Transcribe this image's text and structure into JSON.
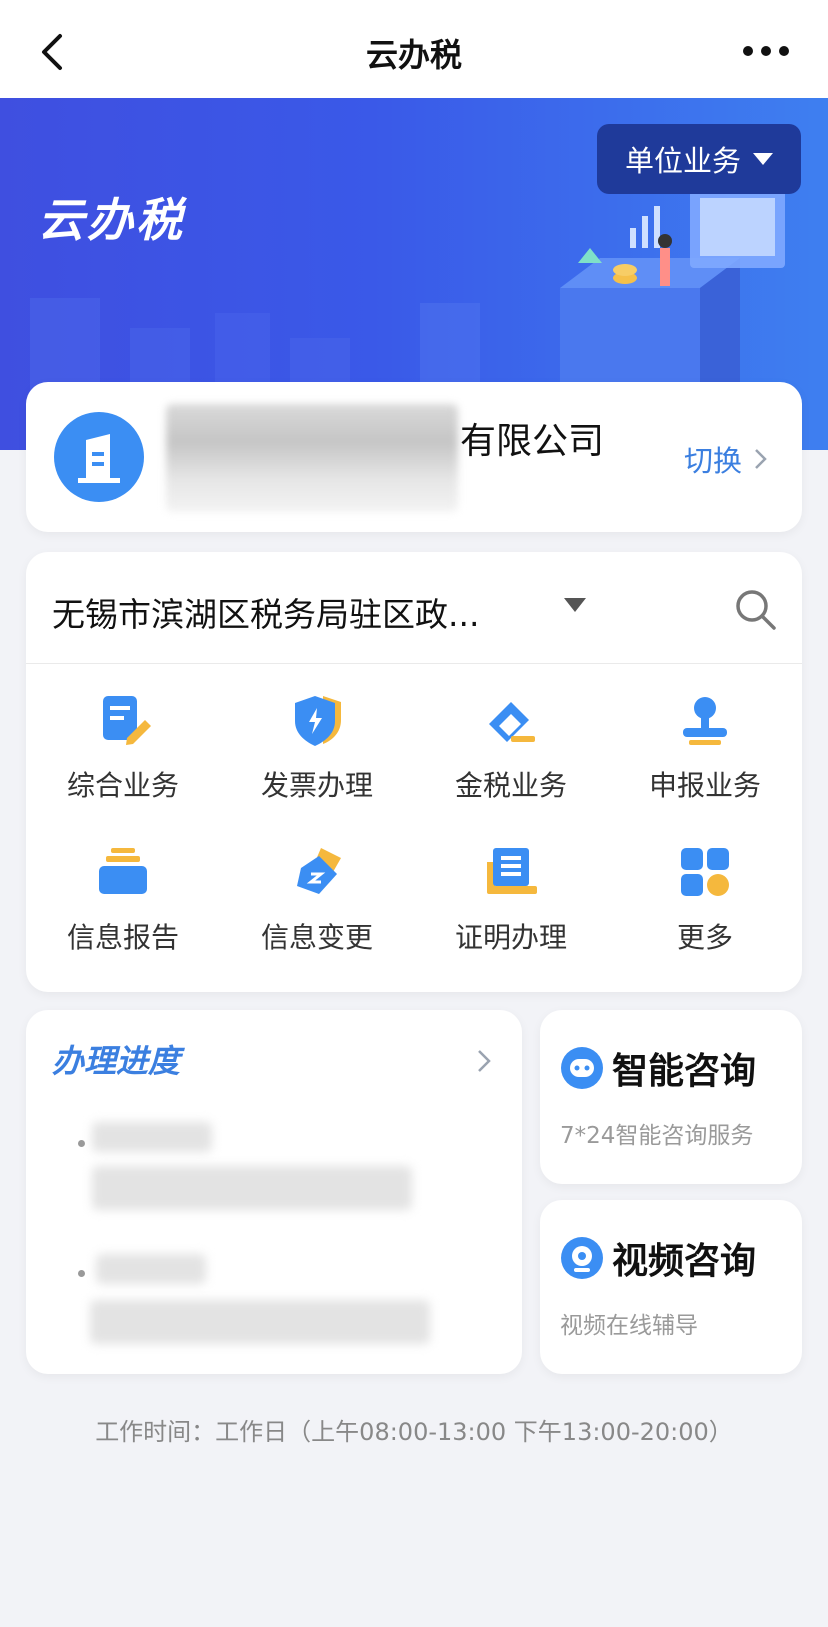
{
  "nav": {
    "title": "云办税"
  },
  "banner": {
    "title": "云办税",
    "unit_button": "单位业务"
  },
  "company": {
    "name_suffix": "有限公司",
    "switch_label": "切换"
  },
  "bureau": {
    "name": "无锡市滨湖区税务局驻区政..."
  },
  "services": [
    {
      "label": "综合业务",
      "icon": "document-edit-icon"
    },
    {
      "label": "发票办理",
      "icon": "shield-lightning-icon"
    },
    {
      "label": "金税业务",
      "icon": "eraser-icon"
    },
    {
      "label": "申报业务",
      "icon": "stamp-icon"
    },
    {
      "label": "信息报告",
      "icon": "tray-stack-icon"
    },
    {
      "label": "信息变更",
      "icon": "ticket-icon"
    },
    {
      "label": "证明办理",
      "icon": "book-tray-icon"
    },
    {
      "label": "更多",
      "icon": "grid-more-icon"
    }
  ],
  "progress": {
    "title": "办理进度"
  },
  "consult": [
    {
      "title": "智能咨询",
      "subtitle": "7*24智能咨询服务",
      "icon": "chat-bot-icon"
    },
    {
      "title": "视频咨询",
      "subtitle": "视频在线辅导",
      "icon": "webcam-icon"
    }
  ],
  "footer": {
    "work_hours": "工作时间：工作日（上午08:00-13:00 下午13:00-20:00）"
  },
  "colors": {
    "accent": "#3b7fe0",
    "banner": "#3f4fe0",
    "unit_button": "#1f3a9a",
    "icon_yellow": "#f5b83d"
  }
}
